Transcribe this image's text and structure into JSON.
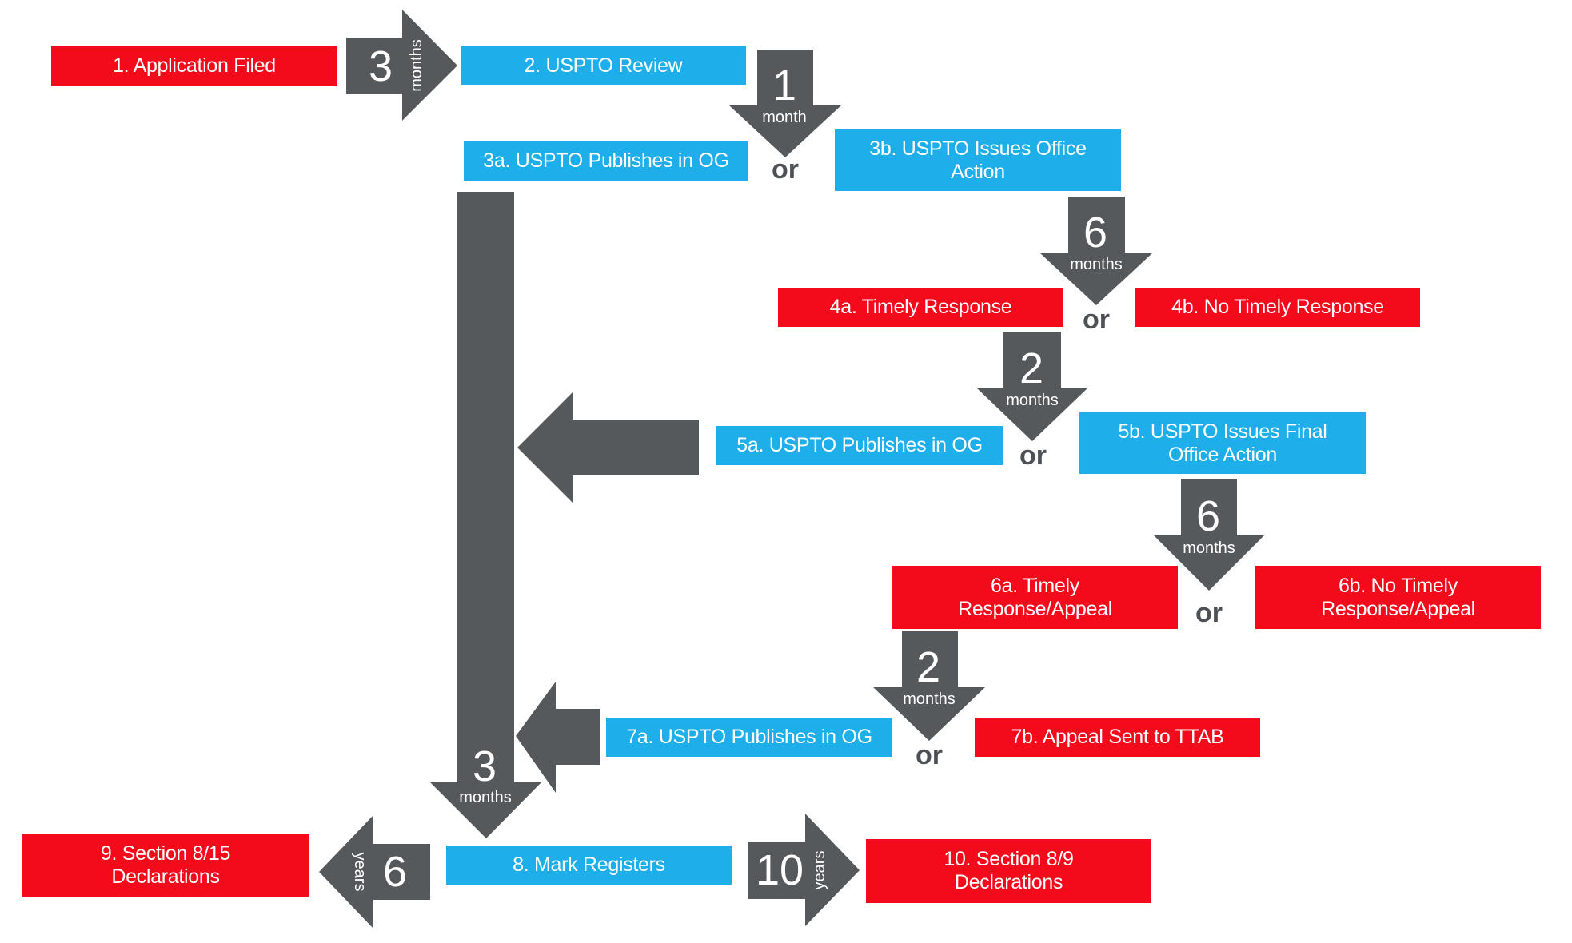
{
  "diagram": {
    "type": "trademark-registration-timeline",
    "colors": {
      "filer_step": "#f40b1b",
      "uspto_step": "#1eaee9",
      "arrow": "#56595c",
      "or_text": "#4d5155"
    },
    "steps": {
      "s1": "1. Application Filed",
      "s2": "2. USPTO Review",
      "s3a": "3a. USPTO Publishes in OG",
      "s3b": "3b. USPTO  Issues Office Action",
      "s4a": "4a. Timely Response",
      "s4b": "4b. No Timely Response",
      "s5a": "5a. USPTO  Publishes in OG",
      "s5b": "5b. USPTO  Issues Final Office Action",
      "s6a": "6a. Timely Response/Appeal",
      "s6b": "6b. No Timely Response/Appeal",
      "s7a": "7a. USPTO  Publishes in OG",
      "s7b": "7b. Appeal Sent to TTAB",
      "s8": "8. Mark Registers",
      "s9": "9. Section 8/15 Declarations",
      "s10": "10. Section 8/9 Declarations"
    },
    "steps_lines": {
      "s3b": [
        "3b. USPTO  Issues Office",
        "Action"
      ],
      "s5b": [
        "5b. USPTO  Issues Final",
        "Office Action"
      ],
      "s6a": [
        "6a. Timely",
        "Response/Appeal"
      ],
      "s6b": [
        "6b. No Timely",
        "Response/Appeal"
      ],
      "s9": [
        "9. Section 8/15",
        "Declarations"
      ],
      "s10": [
        "10. Section 8/9",
        "Declarations"
      ]
    },
    "durations": {
      "d1": {
        "value": "3",
        "unit": "months"
      },
      "d2": {
        "value": "1",
        "unit": "month"
      },
      "d3": {
        "value": "6",
        "unit": "months"
      },
      "d4": {
        "value": "2",
        "unit": "months"
      },
      "d5": {
        "value": "6",
        "unit": "months"
      },
      "d6": {
        "value": "2",
        "unit": "months"
      },
      "d7": {
        "value": "3",
        "unit": "months"
      },
      "d8": {
        "value": "6",
        "unit": "years"
      },
      "d9": {
        "value": "10",
        "unit": "years"
      }
    },
    "or_label": "or"
  }
}
